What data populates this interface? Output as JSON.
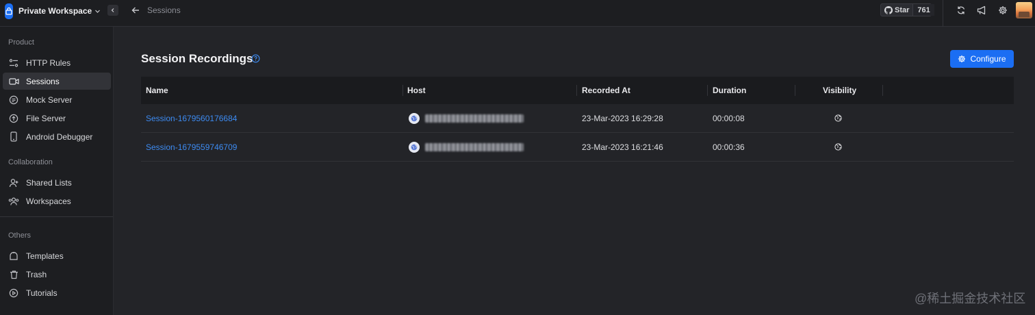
{
  "topbar": {
    "workspace_name": "Private Workspace",
    "breadcrumb": "Sessions",
    "github": {
      "star_label": "Star",
      "star_count": "761"
    },
    "icons": [
      "sync-icon",
      "announcement-icon",
      "gear-icon"
    ]
  },
  "sidebar": {
    "sections": [
      {
        "title": "Product",
        "items": [
          {
            "label": "HTTP Rules",
            "icon": "rules-icon"
          },
          {
            "label": "Sessions",
            "icon": "video-icon",
            "active": true
          },
          {
            "label": "Mock Server",
            "icon": "mock-server-icon"
          },
          {
            "label": "File Server",
            "icon": "file-server-icon"
          },
          {
            "label": "Android Debugger",
            "icon": "phone-icon"
          }
        ]
      },
      {
        "title": "Collaboration",
        "items": [
          {
            "label": "Shared Lists",
            "icon": "add-user-icon"
          },
          {
            "label": "Workspaces",
            "icon": "users-icon"
          }
        ]
      },
      {
        "title": "Others",
        "items": [
          {
            "label": "Templates",
            "icon": "template-icon"
          },
          {
            "label": "Trash",
            "icon": "trash-icon"
          },
          {
            "label": "Tutorials",
            "icon": "play-icon"
          }
        ]
      }
    ]
  },
  "main": {
    "title": "Session Recordings",
    "configure_label": "Configure",
    "table": {
      "columns": [
        "Name",
        "Host",
        "Recorded At",
        "Duration",
        "Visibility"
      ],
      "rows": [
        {
          "name": "Session-1679560176684",
          "recorded_at": "23-Mar-2023 16:29:28",
          "duration": "00:00:08"
        },
        {
          "name": "Session-1679559746709",
          "recorded_at": "23-Mar-2023 16:21:46",
          "duration": "00:00:36"
        }
      ]
    }
  },
  "watermark": "@稀土掘金技术社区",
  "colors": {
    "accent": "#1b6ef3",
    "link": "#3d8bf2",
    "background": "#232428",
    "sidebar": "#1d1e21"
  }
}
